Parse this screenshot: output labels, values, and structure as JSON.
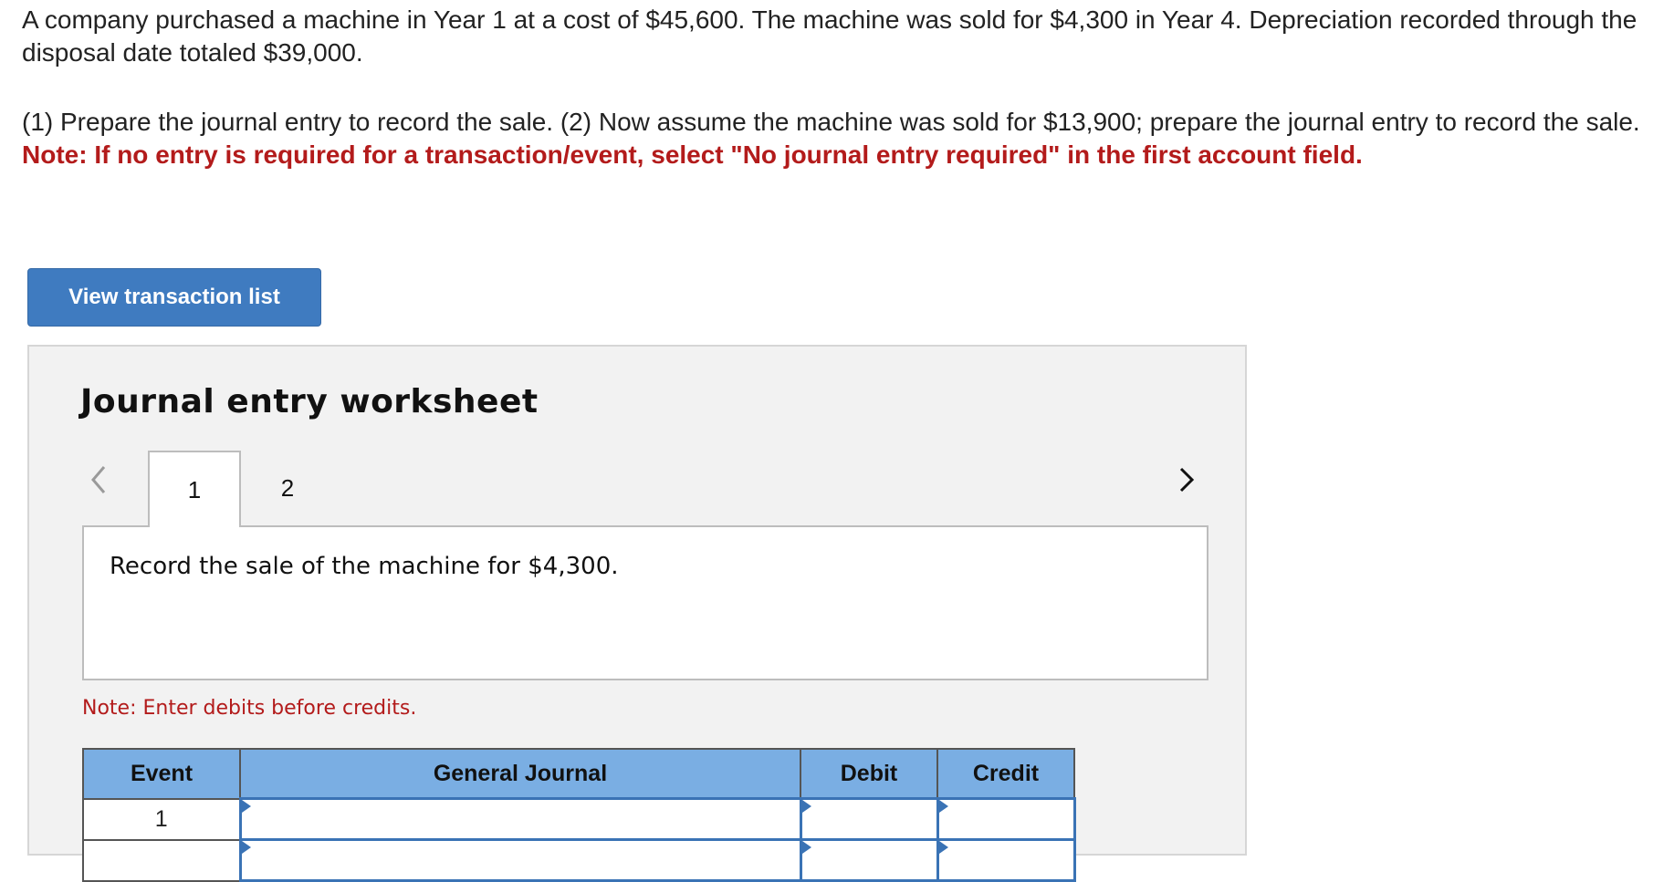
{
  "problem": {
    "paragraph1": "A company purchased a machine in Year 1 at a cost of $45,600. The machine was sold for $4,300 in Year 4. Depreciation recorded through the disposal date totaled $39,000.",
    "paragraph2": "(1) Prepare the journal entry to record the sale. (2) Now assume the machine was sold for $13,900; prepare the journal entry to record the sale.",
    "note": "Note: If no entry is required for a transaction/event, select \"No journal entry required\" in the first account field."
  },
  "buttons": {
    "view_transaction_list": "View transaction list"
  },
  "worksheet": {
    "title": "Journal entry worksheet",
    "tabs": [
      "1",
      "2"
    ],
    "active_tab": "1",
    "description": "Record the sale of the machine for $4,300.",
    "note": "Note: Enter debits before credits.",
    "table": {
      "headers": {
        "event": "Event",
        "general_journal": "General Journal",
        "debit": "Debit",
        "credit": "Credit"
      },
      "rows": [
        {
          "event": "1",
          "account": "",
          "debit": "",
          "credit": ""
        },
        {
          "event": "",
          "account": "",
          "debit": "",
          "credit": ""
        }
      ]
    }
  },
  "icons": {
    "prev": "chevron-left-icon",
    "next": "chevron-right-icon"
  },
  "colors": {
    "button_bg": "#3f7bc0",
    "note_red": "#b31b1b",
    "table_header_bg": "#7aaee3",
    "worksheet_bg": "#f2f2f2"
  }
}
